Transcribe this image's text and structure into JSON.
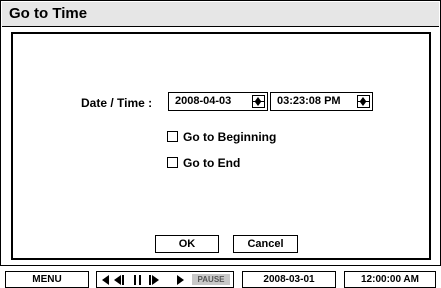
{
  "dialog": {
    "title": "Go to Time",
    "date_time_label": "Date / Time :",
    "date_value": "2008-04-03",
    "time_value": "03:23:08 PM",
    "checkboxes": [
      {
        "label": "Go to Beginning",
        "checked": false
      },
      {
        "label": "Go to End",
        "checked": false
      }
    ],
    "buttons": {
      "ok": "OK",
      "cancel": "Cancel"
    }
  },
  "status_bar": {
    "menu_label": "MENU",
    "pause_label": "PAUSE",
    "date": "2008-03-01",
    "time": "12:00:00 AM"
  },
  "icons": [
    "rewind-icon",
    "step-back-icon",
    "pause-icon",
    "step-forward-icon",
    "play-icon"
  ]
}
